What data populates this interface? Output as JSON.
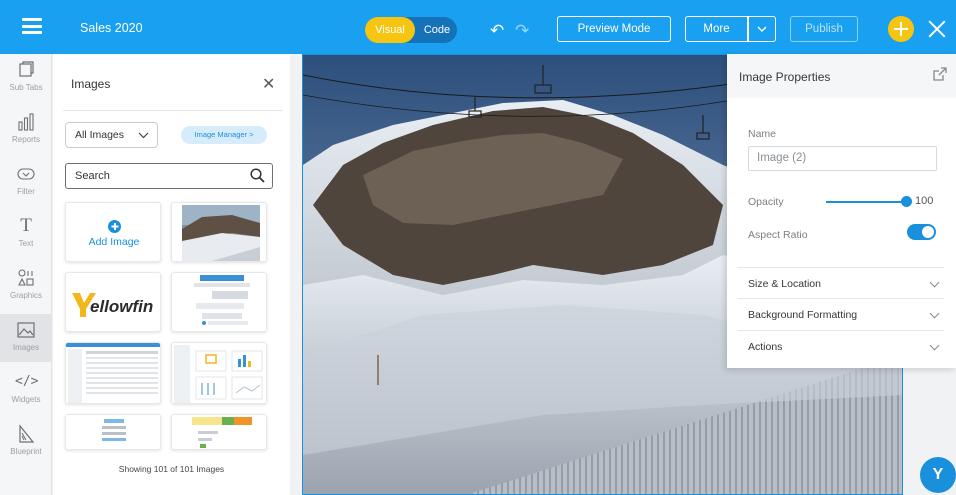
{
  "topbar": {
    "title": "Sales 2020",
    "mode_visual": "Visual",
    "mode_code": "Code",
    "undo_icon": "undo-icon",
    "redo_icon": "redo-icon",
    "preview_label": "Preview Mode",
    "more_label": "More",
    "publish_label": "Publish",
    "accent_color": "#1aa0f0",
    "highlight_color": "#f6c512"
  },
  "rail": {
    "items": [
      {
        "label": "Sub Tabs",
        "icon": "sub-tabs-icon"
      },
      {
        "label": "Reports",
        "icon": "reports-icon"
      },
      {
        "label": "Filter",
        "icon": "filter-icon"
      },
      {
        "label": "Text",
        "icon": "text-icon"
      },
      {
        "label": "Graphics",
        "icon": "graphics-icon"
      },
      {
        "label": "Images",
        "icon": "images-icon",
        "active": true
      },
      {
        "label": "Widgets",
        "icon": "widgets-icon"
      },
      {
        "label": "Blueprint",
        "icon": "blueprint-icon"
      }
    ]
  },
  "images_panel": {
    "title": "Images",
    "filter_value": "All Images",
    "manager_label": "Image Manager >",
    "search_placeholder": "Search",
    "add_image_label": "Add Image",
    "logo_text": "ellowfin",
    "showing_text": "Showing 101 of 101 Images"
  },
  "properties": {
    "title": "Image Properties",
    "name_label": "Name",
    "name_value": "Image (2)",
    "opacity_label": "Opacity",
    "opacity_value": "100",
    "aspect_label": "Aspect Ratio",
    "aspect_on": true,
    "sections": [
      "Size & Location",
      "Background Formatting",
      "Actions"
    ]
  },
  "badge": {
    "letter": "Y"
  }
}
